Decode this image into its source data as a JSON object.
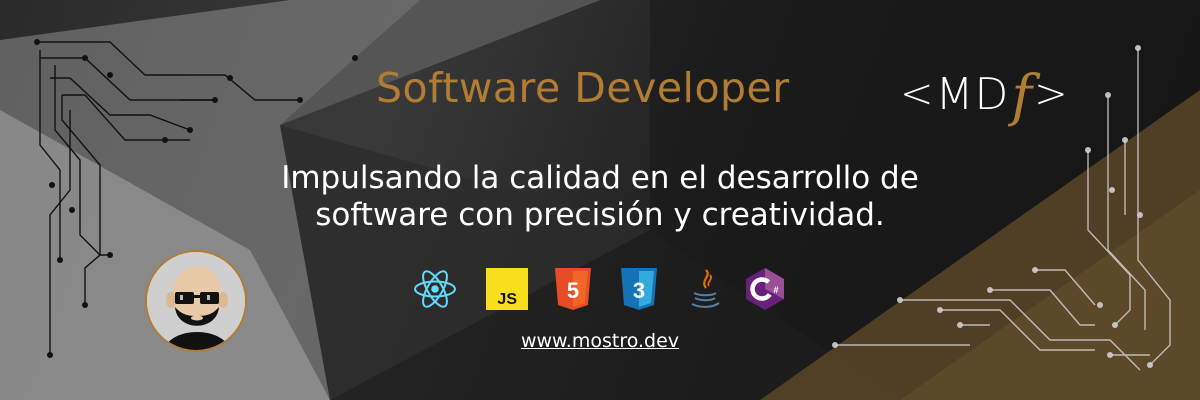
{
  "banner": {
    "title": "Software Developer",
    "tagline_line1": "Impulsando la calidad en el desarrollo de",
    "tagline_line2": "software con precisión y creatividad.",
    "website": "www.mostro.dev",
    "logo": {
      "text_left": "<",
      "text_mid": "MD",
      "text_f": "f",
      "text_right": ">"
    },
    "tech_icons": [
      {
        "name": "react-icon",
        "label": "React"
      },
      {
        "name": "javascript-icon",
        "label": "JS"
      },
      {
        "name": "html5-icon",
        "label": "5"
      },
      {
        "name": "css3-icon",
        "label": "3"
      },
      {
        "name": "java-icon",
        "label": "Java"
      },
      {
        "name": "csharp-icon",
        "label": "C#"
      }
    ],
    "colors": {
      "accent_gold": "#b17d35",
      "white": "#ffffff",
      "react": "#61dafb",
      "js_yellow": "#f7df1e",
      "html_orange": "#e44d26",
      "css_blue": "#1572b6",
      "java_red": "#e76f00",
      "java_blue": "#5382a1",
      "csharp_purple": "#68217a"
    }
  }
}
